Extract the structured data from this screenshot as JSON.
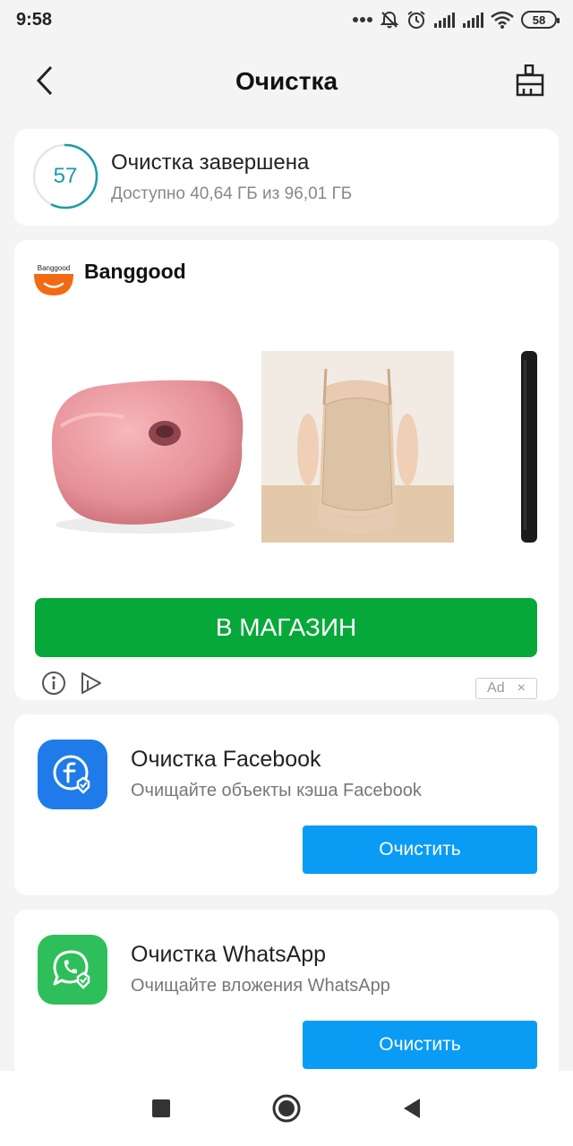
{
  "status_bar": {
    "time": "9:58",
    "battery": "58",
    "icons": [
      "more-dots-icon",
      "mute-bell-icon",
      "alarm-icon",
      "signal-icon",
      "signal-icon",
      "wifi-icon",
      "battery-icon"
    ]
  },
  "header": {
    "title": "Очистка",
    "back_icon": "back-arrow-icon",
    "action_icon": "broom-clean-icon"
  },
  "storage": {
    "score": "57",
    "score_fraction": 0.57,
    "title": "Очистка завершена",
    "subtitle": "Доступно 40,64 ГБ из 96,01 ГБ",
    "accent_color": "#1a9ba8"
  },
  "ad": {
    "brand_logo_text": "Banggood",
    "brand_name": "Banggood",
    "products": [
      "pink-donut-cushion-image",
      "beige-shapewear-image",
      "black-device-image"
    ],
    "cta_label": "В МАГАЗИН",
    "cta_color": "#07a83a",
    "badge_label": "Ad",
    "badge_close": "×"
  },
  "features": [
    {
      "title": "Очистка Facebook",
      "subtitle": "Очищайте объекты кэша Facebook",
      "button": "Очистить",
      "icon": "facebook-clean-icon",
      "icon_color": "#1f7be9"
    },
    {
      "title": "Очистка WhatsApp",
      "subtitle": "Очищайте вложения WhatsApp",
      "button": "Очистить",
      "icon": "whatsapp-clean-icon",
      "icon_color": "#2fbf5a"
    }
  ],
  "colors": {
    "button_blue": "#0a9cf5",
    "background": "#f4f4f4"
  }
}
